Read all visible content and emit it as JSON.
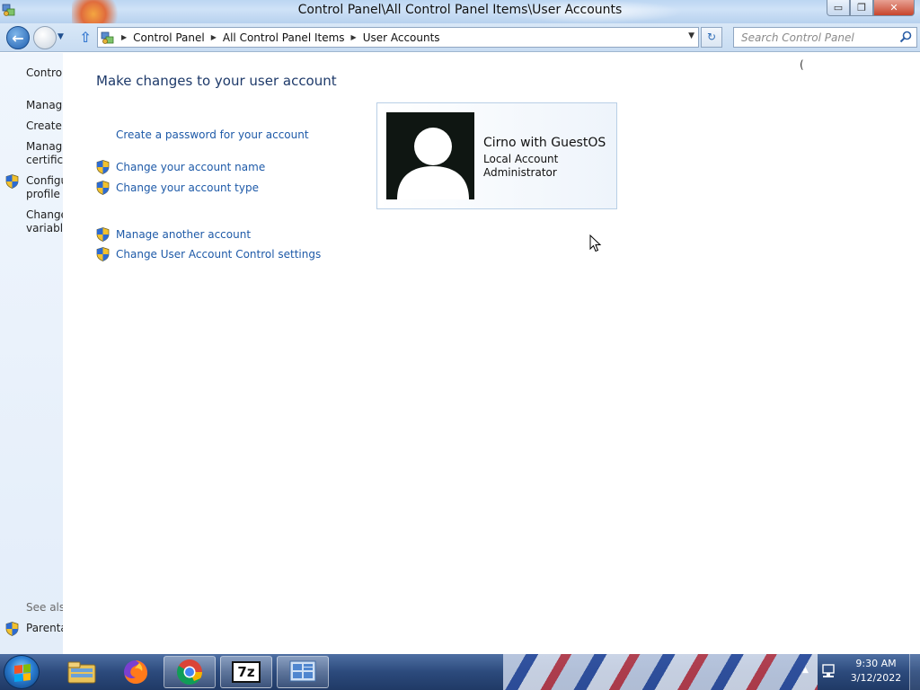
{
  "window": {
    "title": "Control Panel\\All Control Panel Items\\User Accounts",
    "caption_min": "▭",
    "caption_max": "❐",
    "caption_close": "✕"
  },
  "navbar": {
    "breadcrumbs": [
      "Control Panel",
      "All Control Panel Items",
      "User Accounts"
    ],
    "search_placeholder": "Search Control Panel",
    "refresh_glyph": "↻",
    "back_glyph": "←"
  },
  "left_pane": {
    "items": [
      "Control",
      "Manage",
      "Create a",
      "Manage",
      "certifica",
      "Configu",
      "profile p",
      "Change",
      "variable"
    ],
    "see_also": "See also",
    "parental": "Parenta"
  },
  "main": {
    "heading": "Make changes to your user account",
    "links": {
      "create_password": "Create a password for your account",
      "change_name": "Change your account name",
      "change_type": "Change your account type",
      "manage_another": "Manage another account",
      "uac_settings": "Change User Account Control settings"
    },
    "account": {
      "name": "Cirno with GuestOS",
      "type": "Local Account",
      "role": "Administrator"
    }
  },
  "taskbar": {
    "apps": [
      "file-explorer-icon",
      "firefox-icon",
      "chrome-icon",
      "7zip-icon",
      "control-panel-icon"
    ],
    "seven_zip_label": "7z",
    "clock_time": "9:30 AM",
    "clock_date": "3/12/2022"
  },
  "colors": {
    "link": "#1e5aa8",
    "heading": "#1e3a6a",
    "left_pane_bg": "#e3edf9"
  }
}
